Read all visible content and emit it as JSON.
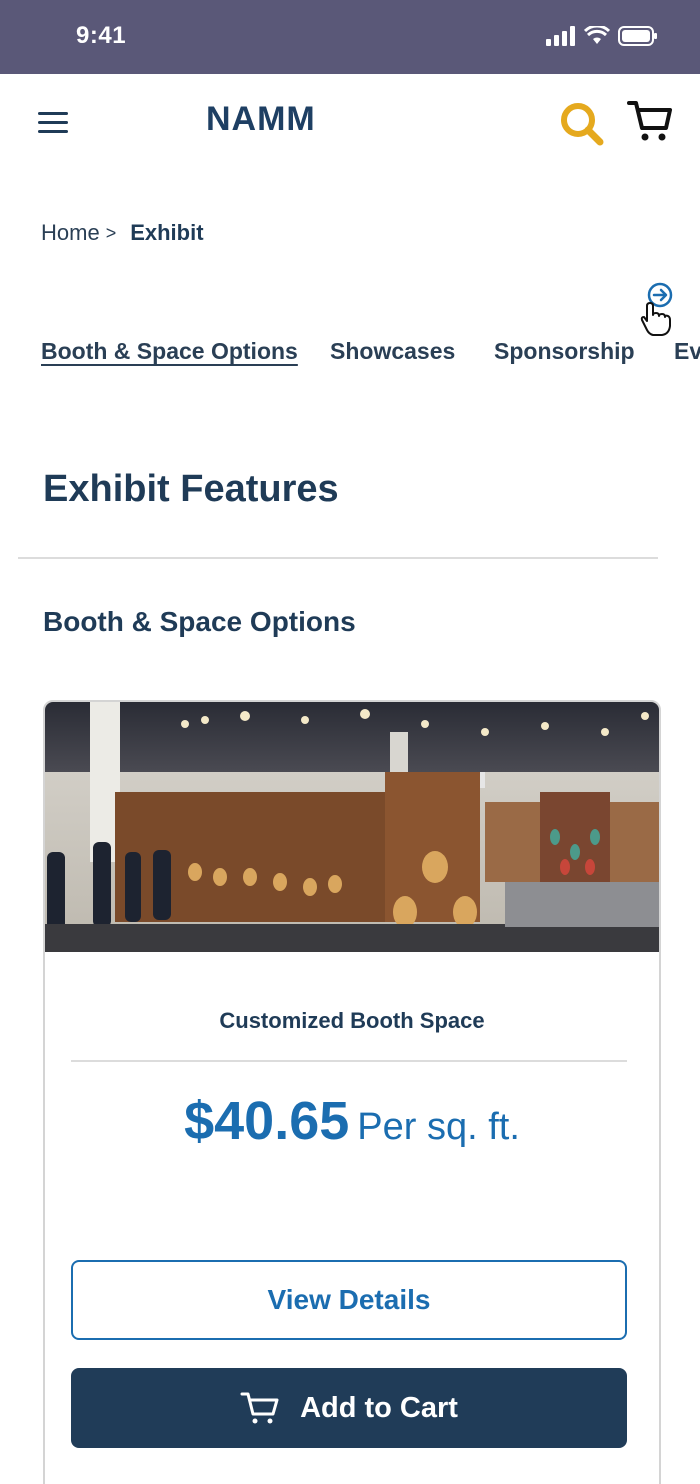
{
  "status_bar": {
    "time": "9:41"
  },
  "header": {
    "logo": "NAMM",
    "menu_icon": "hamburger-menu-icon",
    "search_icon": "search-icon",
    "cart_icon": "cart-icon",
    "search_color": "#e5a91e"
  },
  "breadcrumb": {
    "home": "Home",
    "separator": ">",
    "current": "Exhibit"
  },
  "tabs": [
    {
      "label": "Booth & Space Options",
      "active": true
    },
    {
      "label": "Showcases",
      "active": false
    },
    {
      "label": "Sponsorship",
      "active": false
    },
    {
      "label": "Ev",
      "active": false
    }
  ],
  "scroll_hint_icon": "scroll-right-hand-icon",
  "main": {
    "section_title": "Exhibit Features",
    "subsection_title": "Booth & Space Options",
    "card": {
      "image_icon": "trade-show-booth-photo",
      "title": "Customized Booth Space",
      "price": "$40.65",
      "unit": "Per sq. ft.",
      "view_details_label": "View Details",
      "add_to_cart_label": "Add to Cart"
    }
  },
  "colors": {
    "brand_dark": "#1f3b57",
    "accent_blue": "#1b6db0",
    "status_bar": "#5a5878"
  }
}
